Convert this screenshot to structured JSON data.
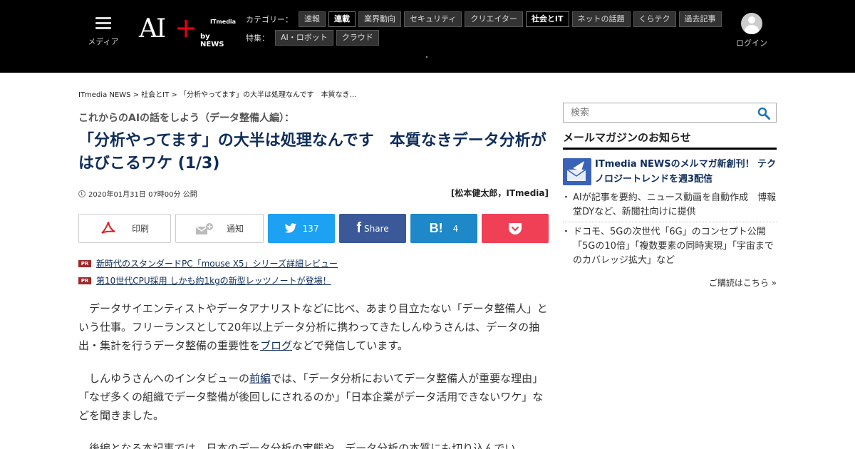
{
  "header": {
    "menu_label": "メディア",
    "logo": {
      "ai": "AI",
      "plus": "+",
      "itmedia": "ITmedia",
      "by": "by NEWS"
    },
    "category_title": "カテゴリー：",
    "categories": [
      {
        "label": "速報",
        "active": false
      },
      {
        "label": "連載",
        "active": true
      },
      {
        "label": "業界動向",
        "active": false
      },
      {
        "label": "セキュリティ",
        "active": false
      },
      {
        "label": "クリエイター",
        "active": false
      },
      {
        "label": "社会とIT",
        "active": true
      },
      {
        "label": "ネットの話題",
        "active": false
      },
      {
        "label": "くらテク",
        "active": false
      },
      {
        "label": "過去記事",
        "active": false
      }
    ],
    "feature_title": "特集：",
    "features": [
      {
        "label": "AI・ロボット"
      },
      {
        "label": "クラウド"
      }
    ],
    "login_label": "ログイン"
  },
  "article": {
    "breadcrumb": "ITmedia NEWS > 社会とIT > 「分析やってます」の大半は処理なんです　本質なき…",
    "series": "これからのAIの話をしよう（データ整備人編）：",
    "headline": "「分析やってます」の大半は処理なんです　本質なきデータ分析がはびこるワケ (1/3)",
    "date": "2020年01月31日 07時00分 公開",
    "author": "[松本健太郎，ITmedia]",
    "share": {
      "print_label": "印刷",
      "notify_label": "通知",
      "twitter_count": "137",
      "facebook_label": "Share",
      "hatena_count": "4"
    },
    "pr": [
      {
        "badge": "PR",
        "text": "新時代のスタンダードPC「mouse X5」シリーズ詳細レビュー"
      },
      {
        "badge": "PR",
        "text": "第10世代CPU採用 しかも約1kgの新型レッツノートが登場！"
      }
    ],
    "p1_before": "データサイエンティストやデータアナリストなどに比べ、あまり目立たない「データ整備人」という仕事。フリーランスとして20年以上データ分析に携わってきたしんゆうさんは、データの抽出・集計を行うデータ整備の重要性を",
    "p1_link": "ブログ",
    "p1_after": "などで発信しています。",
    "p2_before": "しんゆうさんへのインタビューの",
    "p2_link": "前編",
    "p2_after": "では、「データ分析においてデータ整備人が重要な理由」「なぜ多くの組織でデータ整備が後回しにされるのか」「日本企業がデータ活用できないワケ」などを聞きました。",
    "p3": "後編となる本記事では、日本のデータ分析の実態や、データ分析の本質にも切り込んでい"
  },
  "sidebar": {
    "search_placeholder": "検索",
    "mm_title": "メールマガジンのお知らせ",
    "mm_feature": "ITmedia NEWSのメルマガ新創刊！ テクノロジートレンドを週3配信",
    "items": [
      "AIが記事を要約、ニュース動画を自動作成　博報堂DYなど、新聞社向けに提供",
      "ドコモ、5Gの次世代「6G」のコンセプト公開　「5Gの10倍」「複数要素の同時実現」「宇宙までのカバレッジ拡大」など"
    ],
    "more": "ご購読はこちら »"
  },
  "colors": {
    "header_bg": "#000000",
    "headline": "#0f2d5a",
    "twitter": "#1da1f2",
    "facebook": "#3b5998",
    "hatena": "#1e88c8",
    "pocket": "#ef4056",
    "pr_badge": "#a0282b",
    "logo_plus": "#e60012"
  }
}
